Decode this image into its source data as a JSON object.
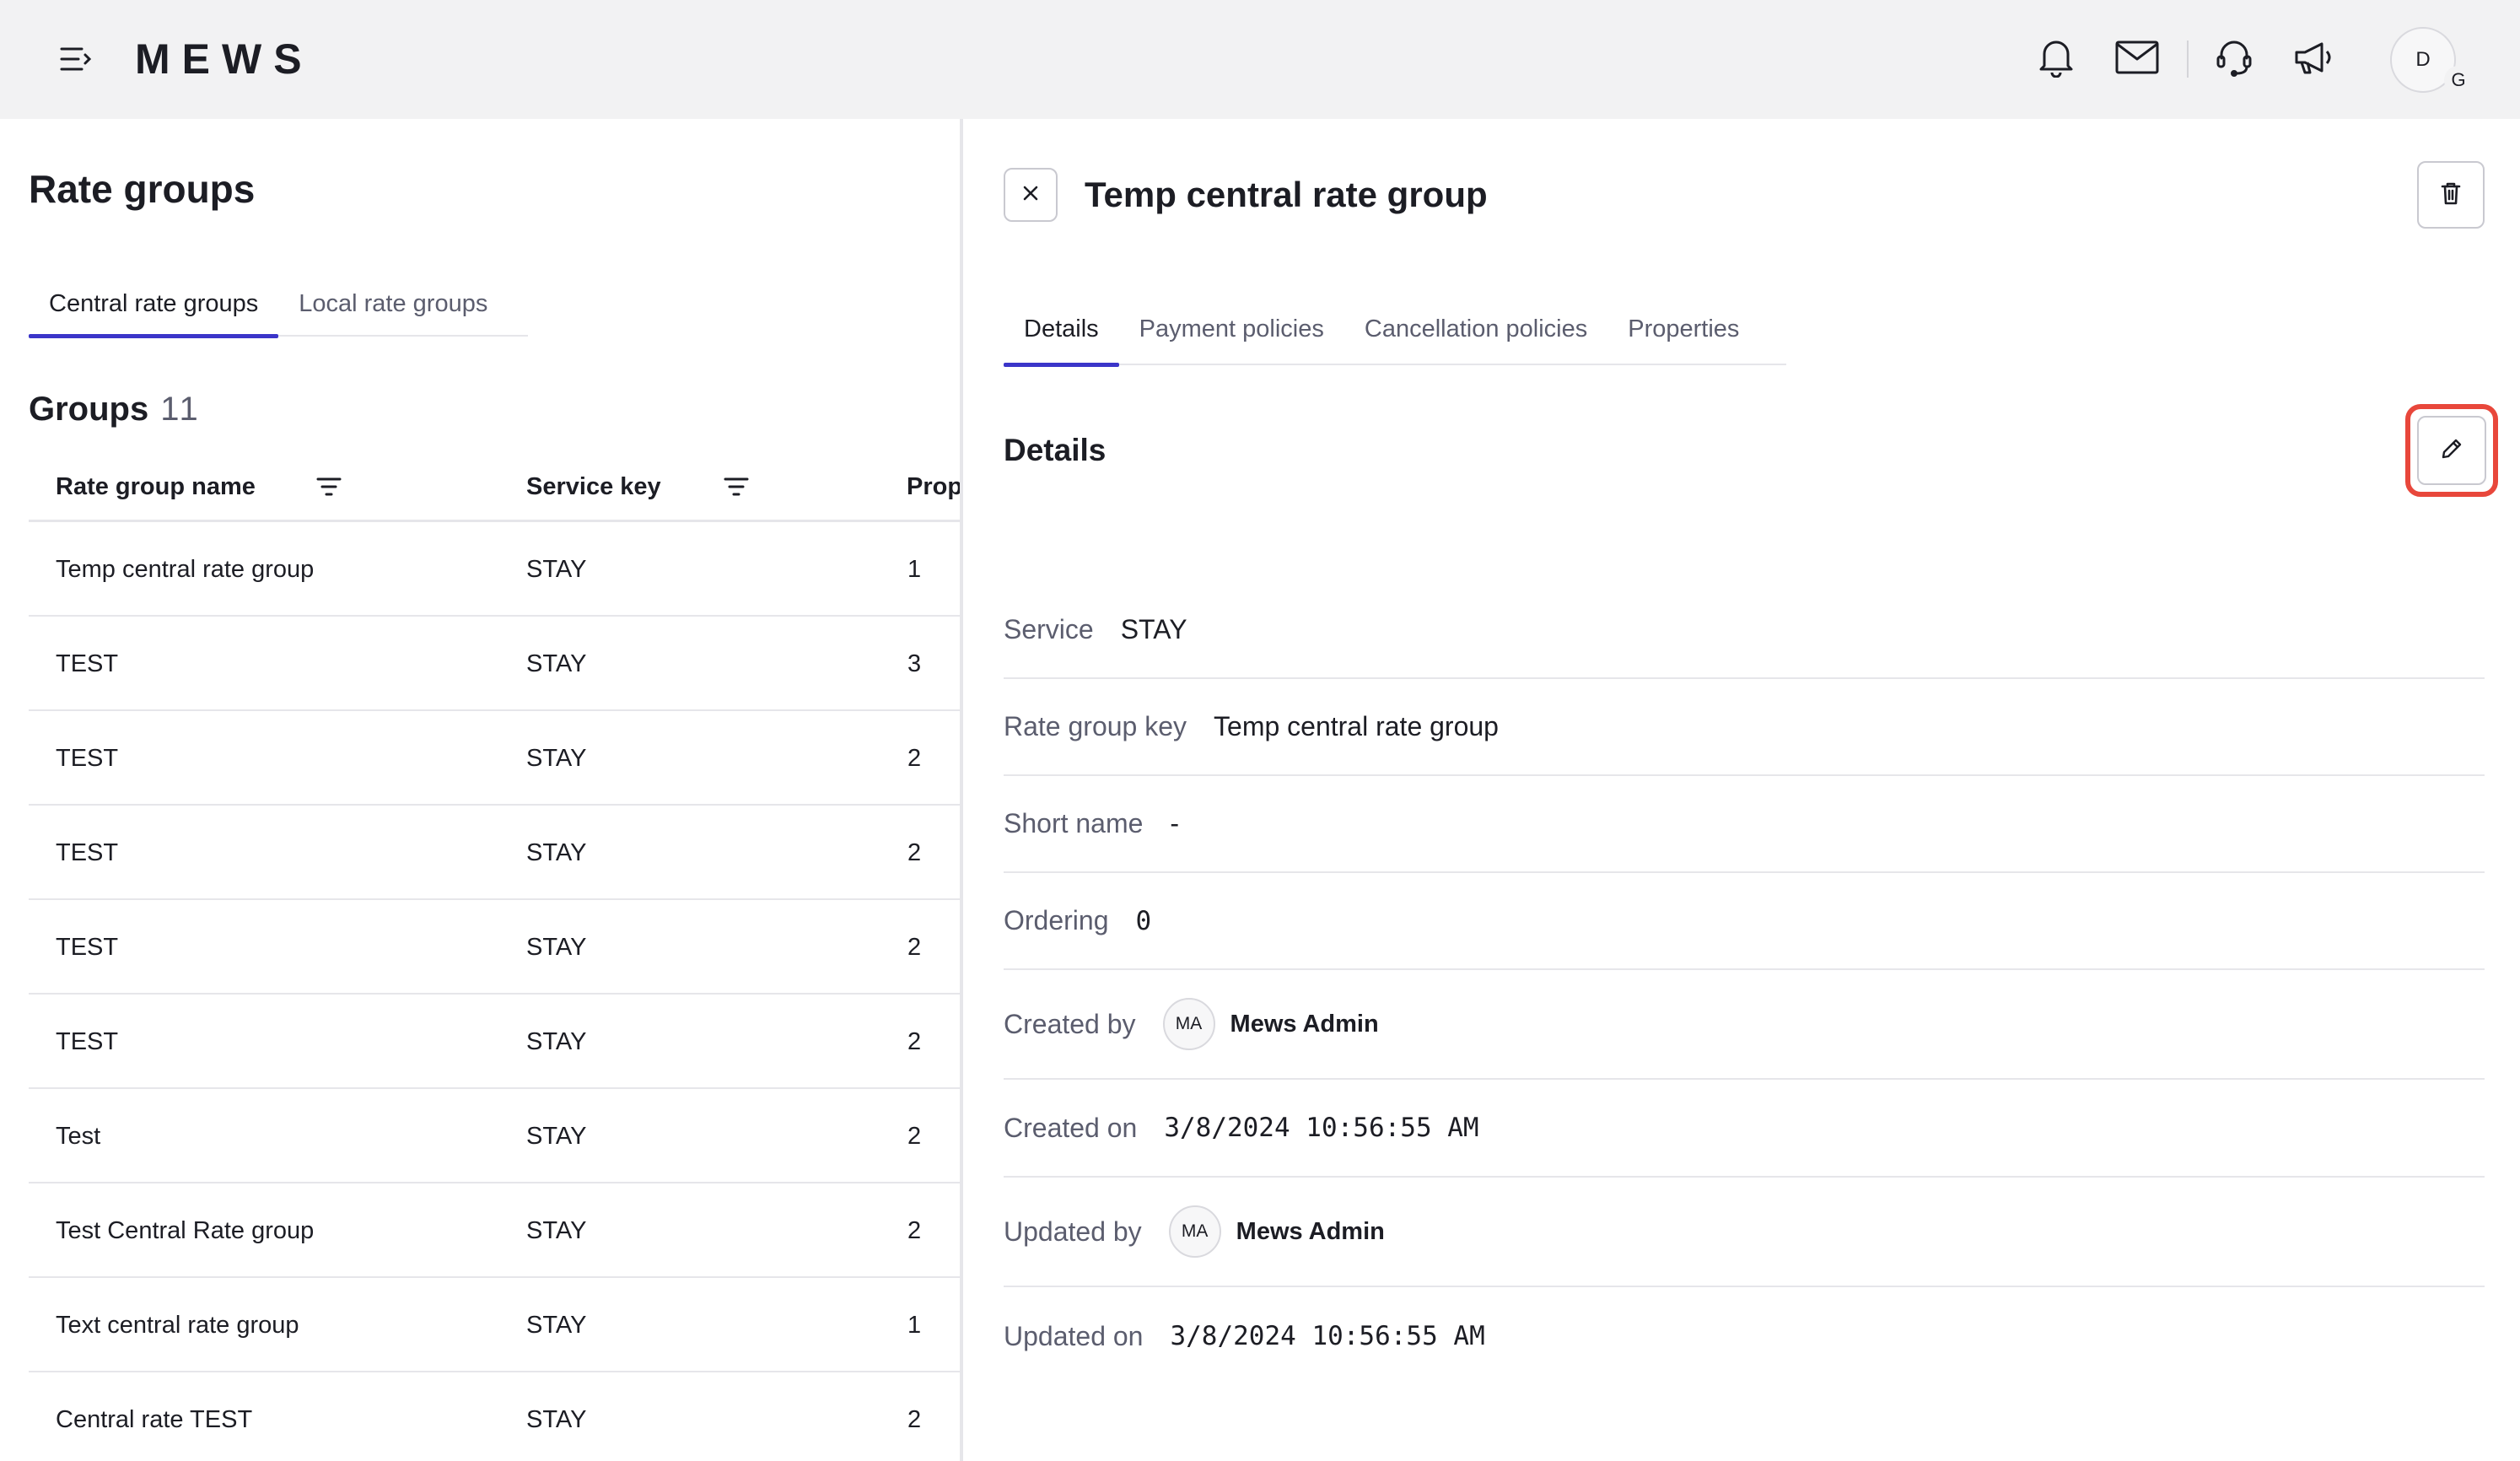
{
  "header": {
    "logo": "MEWS",
    "avatar_initial": "D",
    "avatar_badge": "G"
  },
  "left": {
    "title": "Rate groups",
    "tabs": [
      {
        "label": "Central rate groups",
        "active": true
      },
      {
        "label": "Local rate groups",
        "active": false
      }
    ],
    "groups_label": "Groups",
    "groups_count": "11",
    "columns": [
      "Rate group name",
      "Service key",
      "Prop"
    ],
    "rows": [
      {
        "name": "Temp central rate group",
        "service": "STAY",
        "prop": "1"
      },
      {
        "name": "TEST",
        "service": "STAY",
        "prop": "3"
      },
      {
        "name": "TEST",
        "service": "STAY",
        "prop": "2"
      },
      {
        "name": "TEST",
        "service": "STAY",
        "prop": "2"
      },
      {
        "name": "TEST",
        "service": "STAY",
        "prop": "2"
      },
      {
        "name": "TEST",
        "service": "STAY",
        "prop": "2"
      },
      {
        "name": "Test",
        "service": "STAY",
        "prop": "2"
      },
      {
        "name": "Test Central Rate group",
        "service": "STAY",
        "prop": "2"
      },
      {
        "name": "Text central rate group",
        "service": "STAY",
        "prop": "1"
      },
      {
        "name": "Central rate TEST",
        "service": "STAY",
        "prop": "2"
      }
    ]
  },
  "detail": {
    "title": "Temp central rate group",
    "tabs": [
      {
        "label": "Details",
        "active": true
      },
      {
        "label": "Payment policies",
        "active": false
      },
      {
        "label": "Cancellation policies",
        "active": false
      },
      {
        "label": "Properties",
        "active": false
      }
    ],
    "section_title": "Details",
    "fields": {
      "service": {
        "label": "Service",
        "value": "STAY"
      },
      "rate_group_key": {
        "label": "Rate group key",
        "value": "Temp central rate group"
      },
      "short_name": {
        "label": "Short name",
        "value": "-"
      },
      "ordering": {
        "label": "Ordering",
        "value": "0"
      },
      "created_by": {
        "label": "Created by",
        "initials": "MA",
        "name": "Mews Admin"
      },
      "created_on": {
        "label": "Created on",
        "value": "3/8/2024 10:56:55 AM"
      },
      "updated_by": {
        "label": "Updated by",
        "initials": "MA",
        "name": "Mews Admin"
      },
      "updated_on": {
        "label": "Updated on",
        "value": "3/8/2024 10:56:55 AM"
      }
    }
  },
  "colors": {
    "accent": "#3b35c9",
    "highlight": "#e8473b",
    "topbar_bg": "#f2f2f3",
    "muted_text": "#5b5d6e"
  },
  "icons": [
    "menu-collapse-icon",
    "bell-icon",
    "mail-icon",
    "headset-icon",
    "megaphone-icon",
    "filter-icon",
    "close-icon",
    "trash-icon",
    "pencil-icon"
  ]
}
